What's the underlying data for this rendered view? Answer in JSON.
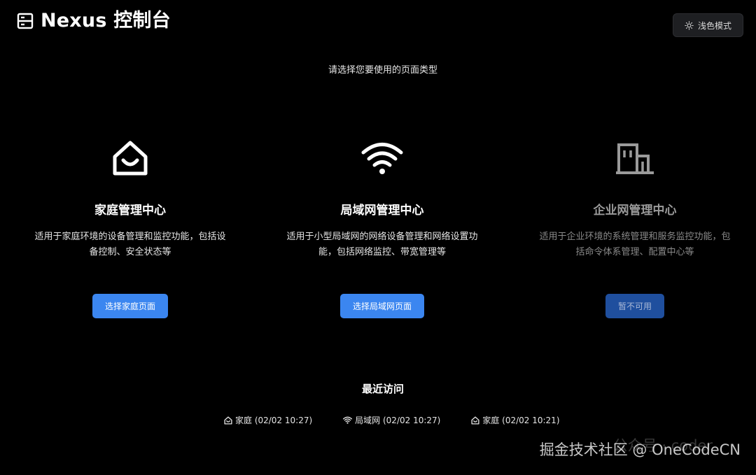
{
  "header": {
    "title": "Nexus 控制台",
    "theme_toggle_label": "浅色模式"
  },
  "prompt": "请选择您要使用的页面类型",
  "cards": [
    {
      "icon": "home-icon",
      "title": "家庭管理中心",
      "description": "适用于家庭环境的设备管理和监控功能，包括设备控制、安全状态等",
      "button_label": "选择家庭页面",
      "enabled": true
    },
    {
      "icon": "wifi-icon",
      "title": "局域网管理中心",
      "description": "适用于小型局域网的网络设备管理和网络设置功能，包括网络监控、带宽管理等",
      "button_label": "选择局域网页面",
      "enabled": true
    },
    {
      "icon": "building-icon",
      "title": "企业网管理中心",
      "description": "适用于企业环境的系统管理和服务监控功能，包括命令体系管理、配置中心等",
      "button_label": "暂不可用",
      "enabled": false
    }
  ],
  "recent": {
    "title": "最近访问",
    "items": [
      {
        "icon": "home-icon",
        "label": "家庭 (02/02 10:27)"
      },
      {
        "icon": "wifi-icon",
        "label": "局域网 (02/02 10:27)"
      },
      {
        "icon": "home-icon",
        "label": "家庭 (02/02 10:21)"
      }
    ]
  },
  "watermark": {
    "overlay": "公众号 · coder",
    "text": "掘金技术社区 @ OneCodeCN"
  },
  "colors": {
    "background": "#000000",
    "primary_button": "#3b86f0",
    "disabled_button": "#1f4f9e"
  }
}
